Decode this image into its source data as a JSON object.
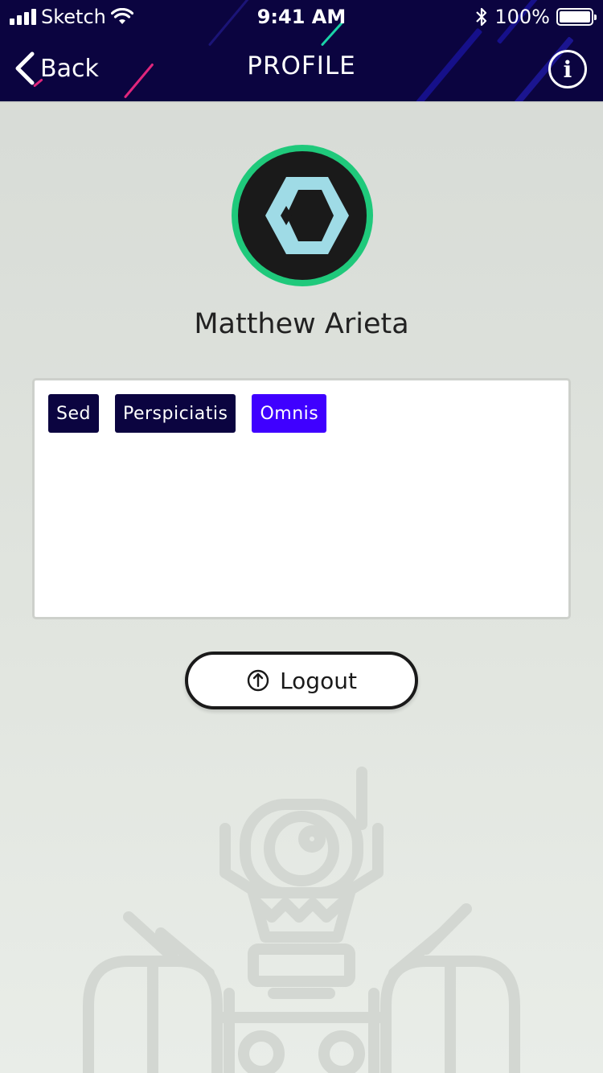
{
  "status_bar": {
    "carrier": "Sketch",
    "time": "9:41 AM",
    "battery": "100%"
  },
  "nav": {
    "back_label": "Back",
    "title": "PROFILE",
    "info_icon": "i"
  },
  "profile": {
    "name": "Matthew Arieta"
  },
  "tags": [
    {
      "label": "Sed",
      "active": false
    },
    {
      "label": "Perspiciatis",
      "active": false
    },
    {
      "label": "Omnis",
      "active": true
    }
  ],
  "logout": {
    "label": "Logout",
    "icon": "power-icon"
  },
  "colors": {
    "header_bg": "#0b0440",
    "tag_bg": "#0b0440",
    "tag_active_bg": "#3f00ff",
    "avatar_ring": "#1fc97b",
    "avatar_logo": "#9fdbe6"
  }
}
